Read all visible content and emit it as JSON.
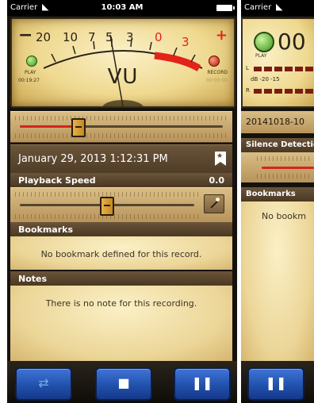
{
  "status": {
    "carrier": "Carrier",
    "time": "10:03 AM"
  },
  "vu_meter": {
    "scale": [
      "20",
      "10",
      "7",
      "5",
      "3",
      "0",
      "3"
    ],
    "minus": "−",
    "plus": "+",
    "label": "VU",
    "play_label": "PLAY",
    "play_time": "00:19:27",
    "record_label": "RECORD",
    "record_time": "00:00:00"
  },
  "playback_position": 0.29,
  "recording": {
    "date": "January 29, 2013 1:12:31 PM",
    "playback_speed_label": "Playback Speed",
    "playback_speed_value": "0.0",
    "playback_speed_position": 0.5
  },
  "bookmarks": {
    "header": "Bookmarks",
    "empty_message": "No bookmark defined for this record."
  },
  "notes": {
    "header": "Notes",
    "empty_message": "There is no note for this recording."
  },
  "toolbar": {
    "left_icon": "swap-arrows-icon",
    "center_icon": "stop-icon",
    "right_icon": "pause-icon"
  },
  "second_screen": {
    "carrier": "Carrier",
    "counter": "00",
    "play_label": "PLAY",
    "l_label": "L",
    "r_label": "R",
    "db_label": "dB -20    -15",
    "file_name": "20141018-10",
    "silence_label": "Silence Detectio",
    "bookmarks_header": "Bookmarks",
    "bookmarks_message": "No bookm"
  },
  "colors": {
    "accent_blue": "#1f4ea8",
    "meter_red": "#e2231a",
    "wood": "#6a543a"
  }
}
